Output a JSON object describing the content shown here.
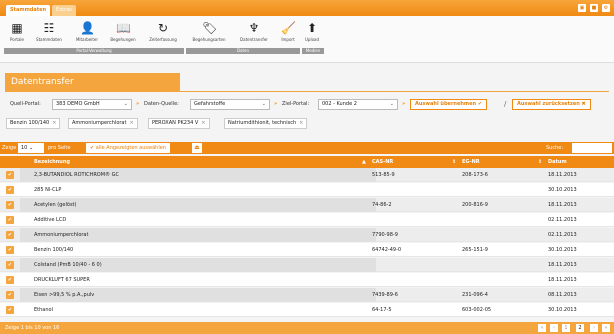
{
  "tabs": {
    "active": "Stammdaten",
    "other": "Extras"
  },
  "window_buttons": [
    "▣",
    "■",
    "⚙"
  ],
  "ribbon": {
    "buttons": [
      {
        "icon": "▦",
        "label": "Portale",
        "name": "portale"
      },
      {
        "icon": "☷",
        "label": "Stammdaten",
        "name": "stammdaten"
      },
      {
        "icon": "👤",
        "label": "Mitarbeiter",
        "name": "mitarbeiter"
      },
      {
        "icon": "📖",
        "label": "Begehungen",
        "name": "begehungen"
      },
      {
        "icon": "↻",
        "label": "Zeiterfassung",
        "name": "zeiterfassung"
      },
      {
        "icon": "🏷",
        "label": "Begehungsarten",
        "name": "begehungsarten"
      },
      {
        "icon": "♆",
        "label": "Datentransfer",
        "name": "datentransfer"
      },
      {
        "icon": "🧹",
        "label": "Import",
        "name": "import"
      },
      {
        "icon": "⬆",
        "label": "Upload",
        "name": "upload"
      }
    ],
    "groups": [
      "Portal-Verwaltung",
      "Daten",
      "Medien"
    ]
  },
  "page_title": "Datentransfer",
  "filters": {
    "quell_label": "Quell-Portal:",
    "quell_value": "383 DEMO GmbH",
    "daten_label": "Daten-Quelle:",
    "daten_value": "Gefahrstoffe",
    "ziel_label": "Ziel-Portal:",
    "ziel_value": "002 - Kunde 2",
    "apply_label": "Auswahl übernehmen ✔",
    "reset_label": "Auswahl zurücksetzen ✖",
    "arrow": "»",
    "slash": "/"
  },
  "chips": [
    "Benzin 100/140",
    "Ammoniumperchlorat",
    "PEROXAN PK234 V",
    "Natriumdithionit, technisch"
  ],
  "grid": {
    "show_label": "Zeige",
    "per_page": "10",
    "per_page_suffix": "pro Seite",
    "select_all": "✔ alle Angezeigten auswählen",
    "search_label": "Suche:",
    "columns": [
      "Bezeichnung",
      "CAS-NR",
      "EG-NR",
      "Datum"
    ],
    "rows": [
      {
        "name": "2,3-BUTANDIOL ROTICHROM® GC",
        "cas": "513-85-9",
        "eg": "208-173-6",
        "date": "18.11.2013"
      },
      {
        "name": "285 Nl-CLP",
        "cas": "",
        "eg": "",
        "date": "30.10.2013"
      },
      {
        "name": "Acetylen (gelöst)",
        "cas": "74-86-2",
        "eg": "200-816-9",
        "date": "18.11.2013"
      },
      {
        "name": "Additive LCD",
        "cas": "",
        "eg": "",
        "date": "02.11.2013"
      },
      {
        "name": "Ammoniumperchlorat",
        "cas": "7790-98-9",
        "eg": "",
        "date": "02.11.2013"
      },
      {
        "name": "Benzin 100/140",
        "cas": "64742-49-0",
        "eg": "265-151-9",
        "date": "30.10.2013"
      },
      {
        "name": "Colstand (PmB 10/40 - 6 0)",
        "cas": "",
        "eg": "",
        "date": "18.11.2013"
      },
      {
        "name": "DRUCKLUFT 67 SUPER",
        "cas": "",
        "eg": "",
        "date": "18.11.2013"
      },
      {
        "name": "Eisen >99,5 % p.A.,pulv",
        "cas": "7439-89-6",
        "eg": "231-096-4",
        "date": "08.11.2013"
      },
      {
        "name": "Ethanol",
        "cas": "64-17-5",
        "eg": "603-002-05",
        "date": "30.10.2013"
      }
    ]
  },
  "footer": {
    "info": "Zeige 1 bis 10 von 16",
    "pages": [
      "«",
      "‹",
      "1",
      "2",
      "›",
      "»"
    ]
  }
}
